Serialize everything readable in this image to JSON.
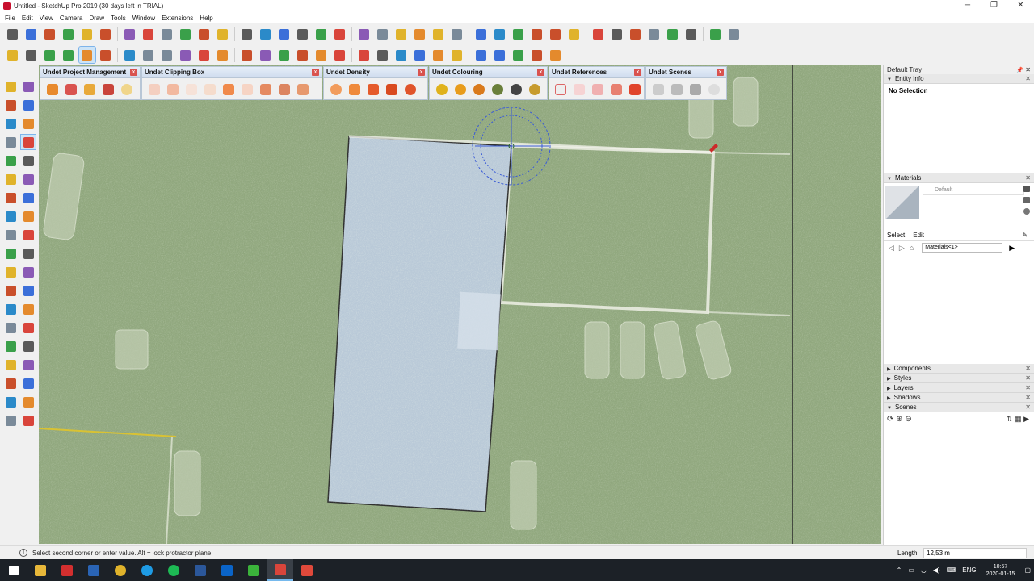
{
  "window": {
    "title": "Untitled - SketchUp Pro 2019 (30 days left in TRIAL)",
    "minimize": "─",
    "restore": "❐",
    "close": "✕"
  },
  "menu": [
    "File",
    "Edit",
    "View",
    "Camera",
    "Draw",
    "Tools",
    "Window",
    "Extensions",
    "Help"
  ],
  "undet_toolbars": {
    "project_management": "Undet Project Management",
    "clipping_box": "Undet Clipping Box",
    "density": "Undet Density",
    "colouring": "Undet Colouring",
    "references": "Undet References",
    "scenes": "Undet Scenes",
    "close_symbol": "x"
  },
  "tray": {
    "title": "Default Tray",
    "pin": "📌",
    "close": "✕",
    "entity_info": {
      "label": "Entity Info",
      "content": "No Selection"
    },
    "materials": {
      "label": "Materials",
      "current": "Default",
      "tab_select": "Select",
      "tab_edit": "Edit",
      "collection": "Materials<1>"
    },
    "collapsed_panels": [
      "Components",
      "Styles",
      "Layers",
      "Shadows"
    ],
    "scenes": {
      "label": "Scenes"
    }
  },
  "status": {
    "message": "Select second corner or enter value. Alt = lock protractor plane.",
    "measure_label": "Length",
    "measure_value": "12,53 m"
  },
  "taskbar": {
    "language": "ENG",
    "time": "10:57",
    "date": "2020-01-15"
  },
  "colors": {
    "ground": "#92a97f",
    "building_roof": "#b9c9d8",
    "selection_border": "#2d2d2d",
    "protractor": "#3a5bd6",
    "taskbar": "#1c2127",
    "active_tool": "#cde4f7"
  },
  "icons": {
    "toolbar_row_1": [
      "component-icon",
      "open-icon",
      "save-icon",
      "cut-icon",
      "copy-icon",
      "paste-icon",
      "erase-icon",
      "undo-icon",
      "redo-icon",
      "print-icon",
      "model-info-icon",
      "iso-icon",
      "top-icon",
      "front-icon",
      "right-icon",
      "back-icon",
      "left-icon",
      "xray-icon",
      "wireframe-icon",
      "hidden-line-icon",
      "shaded-icon",
      "textured-icon",
      "monochrome-icon",
      "warehouse-icon",
      "share-icon",
      "extension-icon",
      "move-icon",
      "push-pull-icon",
      "rotate-icon",
      "follow-me-icon",
      "scale-icon",
      "offset-icon",
      "tape-icon",
      "dimension-icon",
      "protractor-icon",
      "text-icon",
      "axes-icon",
      "3d-text-icon"
    ],
    "toolbar_row_2": [
      "select-icon",
      "eraser-icon",
      "pencil-icon",
      "arc-icon",
      "rectangle-icon",
      "paint-icon",
      "circle-icon",
      "polygon-icon",
      "move-icon",
      "rotate-icon",
      "scale-icon",
      "pushpull-icon",
      "tape-icon",
      "text-icon",
      "protractor-icon",
      "orbit-icon",
      "pan-icon",
      "zoom-icon",
      "zoom-window-icon",
      "zoom-extents-icon",
      "walk-icon",
      "look-icon",
      "position-camera-icon",
      "section-icon",
      "display-section-icon",
      "fill-section-icon",
      "ruby-icon",
      "warehouse-icon",
      "extension-manager-icon"
    ]
  }
}
